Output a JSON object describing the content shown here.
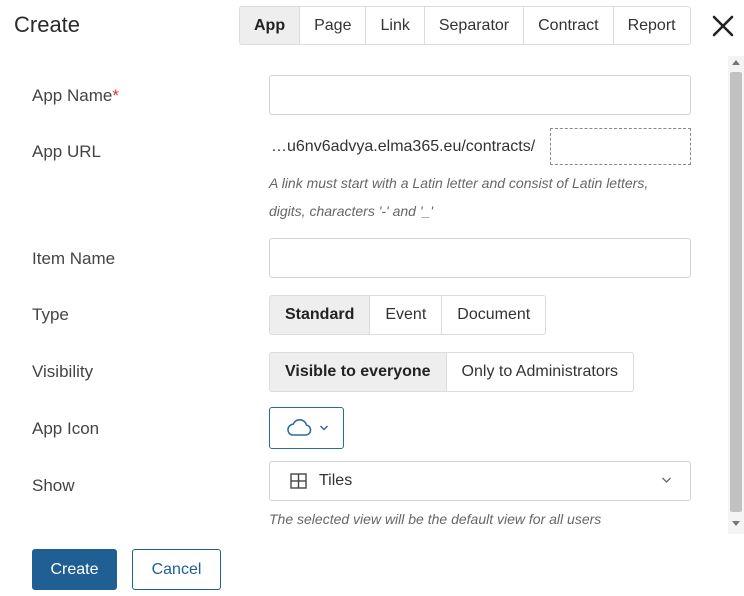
{
  "dialog": {
    "title": "Create"
  },
  "tabs": [
    {
      "label": "App",
      "active": true
    },
    {
      "label": "Page",
      "active": false
    },
    {
      "label": "Link",
      "active": false
    },
    {
      "label": "Separator",
      "active": false
    },
    {
      "label": "Contract",
      "active": false
    },
    {
      "label": "Report",
      "active": false
    }
  ],
  "form": {
    "app_name": {
      "label": "App Name",
      "required_mark": "*",
      "value": ""
    },
    "app_url": {
      "label": "App URL",
      "prefix": "…u6nv6advya.elma365.eu/contracts/",
      "value": "",
      "hint_line1": "A link must start with a Latin letter and consist of Latin letters,",
      "hint_line2": "digits, characters '-' and '_'"
    },
    "item_name": {
      "label": "Item Name",
      "value": ""
    },
    "type": {
      "label": "Type",
      "options": [
        {
          "label": "Standard",
          "active": true
        },
        {
          "label": "Event",
          "active": false
        },
        {
          "label": "Document",
          "active": false
        }
      ]
    },
    "visibility": {
      "label": "Visibility",
      "options": [
        {
          "label": "Visible to everyone",
          "active": true
        },
        {
          "label": "Only to Administrators",
          "active": false
        }
      ]
    },
    "app_icon": {
      "label": "App Icon",
      "icon": "cloud-icon"
    },
    "show": {
      "label": "Show",
      "selected": "Tiles",
      "icon": "grid-icon",
      "hint": "The selected view will be the default view for all users"
    }
  },
  "footer": {
    "create_label": "Create",
    "cancel_label": "Cancel"
  },
  "colors": {
    "primary": "#1f5f93",
    "required": "#e2333a",
    "active_tab_bg": "#eeeeee"
  }
}
